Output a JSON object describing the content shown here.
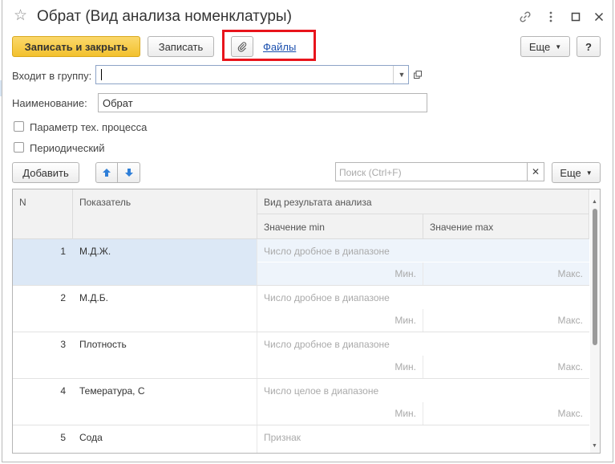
{
  "window": {
    "title": "Обрат (Вид анализа номенклатуры)"
  },
  "toolbar": {
    "save_close_label": "Записать и закрыть",
    "save_label": "Записать",
    "files_label": "Файлы",
    "more_label": "Еще",
    "help_label": "?"
  },
  "form": {
    "group_label": "Входит в группу:",
    "group_value": "",
    "name_label": "Наименование:",
    "name_value": "Обрат",
    "param_label": "Параметр тех. процесса",
    "periodic_label": "Периодический"
  },
  "table_toolbar": {
    "add_label": "Добавить",
    "search_placeholder": "Поиск (Ctrl+F)",
    "more_label": "Еще"
  },
  "table": {
    "headers": {
      "n": "N",
      "indicator": "Показатель",
      "result_type": "Вид результата анализа",
      "min": "Значение min",
      "max": "Значение max"
    },
    "rows": [
      {
        "n": "1",
        "name": "М.Д.Ж.",
        "type": "Число дробное в диапазоне",
        "min": "Мин.",
        "max": "Макс.",
        "selected": true
      },
      {
        "n": "2",
        "name": "М.Д.Б.",
        "type": "Число дробное в диапазоне",
        "min": "Мин.",
        "max": "Макс."
      },
      {
        "n": "3",
        "name": "Плотность",
        "type": "Число дробное в диапазоне",
        "min": "Мин.",
        "max": "Макс."
      },
      {
        "n": "4",
        "name": "Темература, С",
        "type": "Число целое в диапазоне",
        "min": "Мин.",
        "max": "Макс."
      },
      {
        "n": "5",
        "name": "Сода",
        "type": "Признак",
        "min": "",
        "max": ""
      }
    ]
  },
  "colors": {
    "primary_button": "#f2c12e",
    "highlight_border": "#e8141c",
    "link": "#1a4fae",
    "selected_row": "#dce8f6",
    "arrow_blue": "#2f7fd8"
  }
}
